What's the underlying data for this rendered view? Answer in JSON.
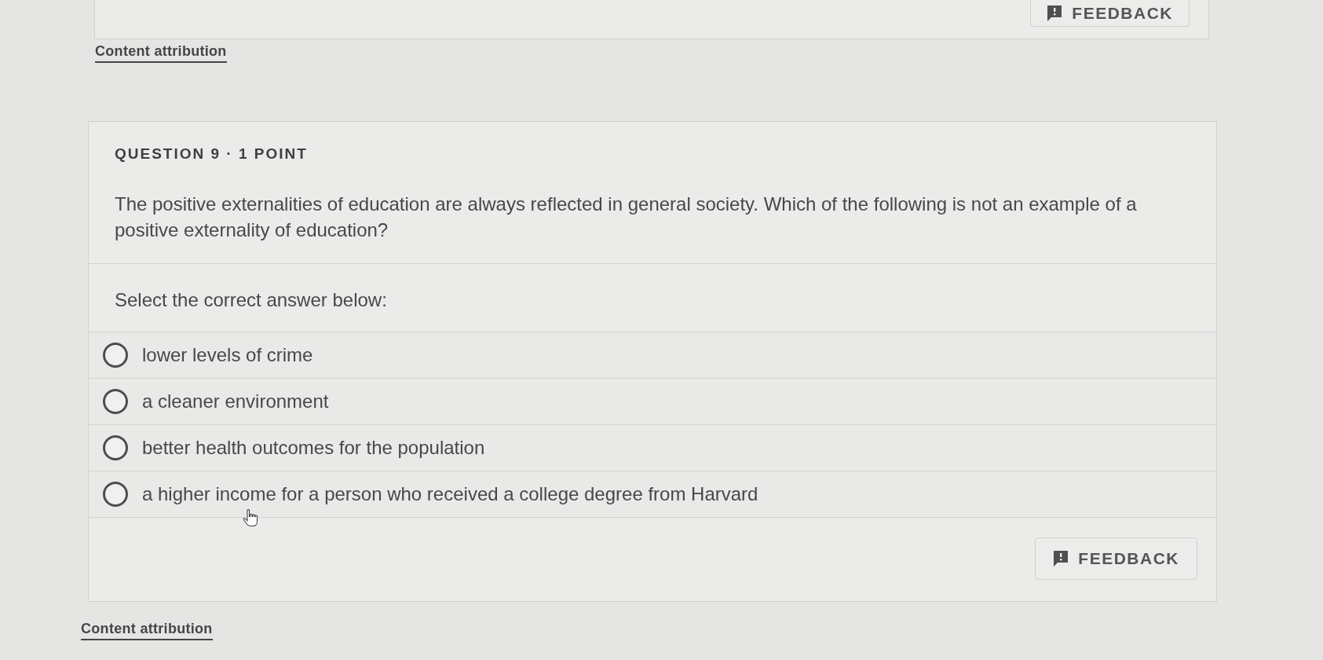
{
  "top_card": {
    "feedback_button": "FEEDBACK"
  },
  "content_attribution_top": "Content attribution",
  "question": {
    "header": "QUESTION 9 · 1 POINT",
    "text": "The positive externalities of education are always reflected in general society. Which of the following is not an example of a positive externality of education?",
    "prompt": "Select the correct answer below:",
    "options": [
      {
        "label": "lower levels of crime",
        "selected": false
      },
      {
        "label": "a cleaner environment",
        "selected": false
      },
      {
        "label": "better health outcomes for the population",
        "selected": false
      },
      {
        "label": "a higher income for a person who received a college degree from Harvard",
        "selected": false
      }
    ],
    "feedback_button": "FEEDBACK"
  },
  "content_attribution_bottom": "Content attribution"
}
